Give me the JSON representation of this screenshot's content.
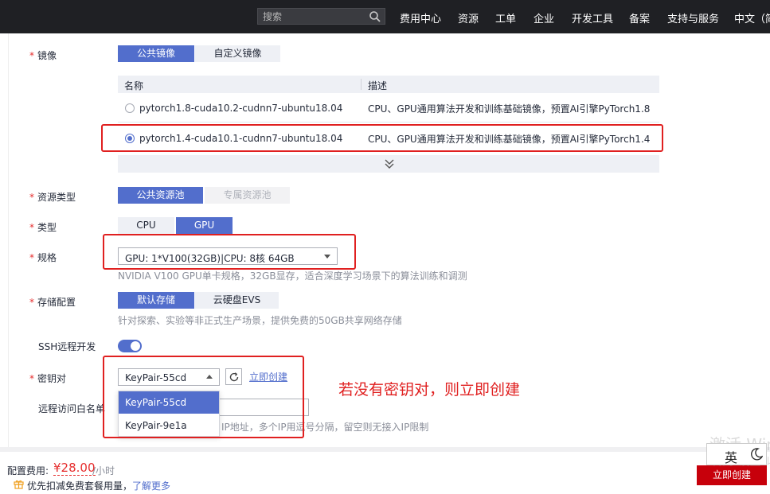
{
  "topnav": {
    "search_placeholder": "搜索",
    "items": [
      "费用中心",
      "资源",
      "工单",
      "企业",
      "开发工具",
      "备案",
      "支持与服务",
      "中文（简"
    ]
  },
  "form": {
    "image": {
      "label": "镜像",
      "tabs": [
        "公共镜像",
        "自定义镜像"
      ],
      "table_headers": [
        "名称",
        "描述"
      ],
      "rows": [
        {
          "name": "pytorch1.8-cuda10.2-cudnn7-ubuntu18.04",
          "desc": "CPU、GPU通用算法开发和训练基础镜像，预置AI引擎PyTorch1.8",
          "selected": false
        },
        {
          "name": "pytorch1.4-cuda10.1-cudnn7-ubuntu18.04",
          "desc": "CPU、GPU通用算法开发和训练基础镜像，预置AI引擎PyTorch1.4",
          "selected": true
        }
      ]
    },
    "resource_type": {
      "label": "资源类型",
      "tabs": [
        "公共资源池",
        "专属资源池"
      ]
    },
    "type": {
      "label": "类型",
      "tabs": [
        "CPU",
        "GPU"
      ]
    },
    "spec": {
      "label": "规格",
      "value": "GPU: 1*V100(32GB)|CPU: 8核 64GB",
      "hint": "NVIDIA V100 GPU单卡规格，32GB显存，适合深度学习场景下的算法训练和调测"
    },
    "storage": {
      "label": "存储配置",
      "tabs": [
        "默认存储",
        "云硬盘EVS"
      ],
      "hint": "针对探索、实验等非正式生产场景，提供免费的50GB共享网络存储"
    },
    "ssh": {
      "label": "SSH远程开发",
      "enabled": true
    },
    "keypair": {
      "label": "密钥对",
      "value": "KeyPair-55cd",
      "create_link": "立即创建",
      "options": [
        "KeyPair-55cd",
        "KeyPair-9e1a"
      ]
    },
    "whitelist": {
      "label": "远程访问白名单",
      "hint": "IP地址，多个IP用逗号分隔，留空则无接入IP限制"
    }
  },
  "annotation": "若没有密钥对，则立即创建",
  "footer": {
    "fee_label": "配置费用:",
    "price": "¥28.00",
    "unit": "/小时",
    "promo_text": "优先扣减免费套餐用量，",
    "promo_link": "了解更多",
    "create_button": "立即创建"
  },
  "overlay": {
    "watermark_line1": "激活 Windows",
    "watermark_line2": "转到\"设置\"以激活",
    "ime_label": "英"
  },
  "colors": {
    "primary": "#526ecc",
    "danger": "#e62e2e",
    "annotation_red": "#e02020",
    "create_btn": "#c7000b",
    "nav_bg": "#1f2024"
  }
}
